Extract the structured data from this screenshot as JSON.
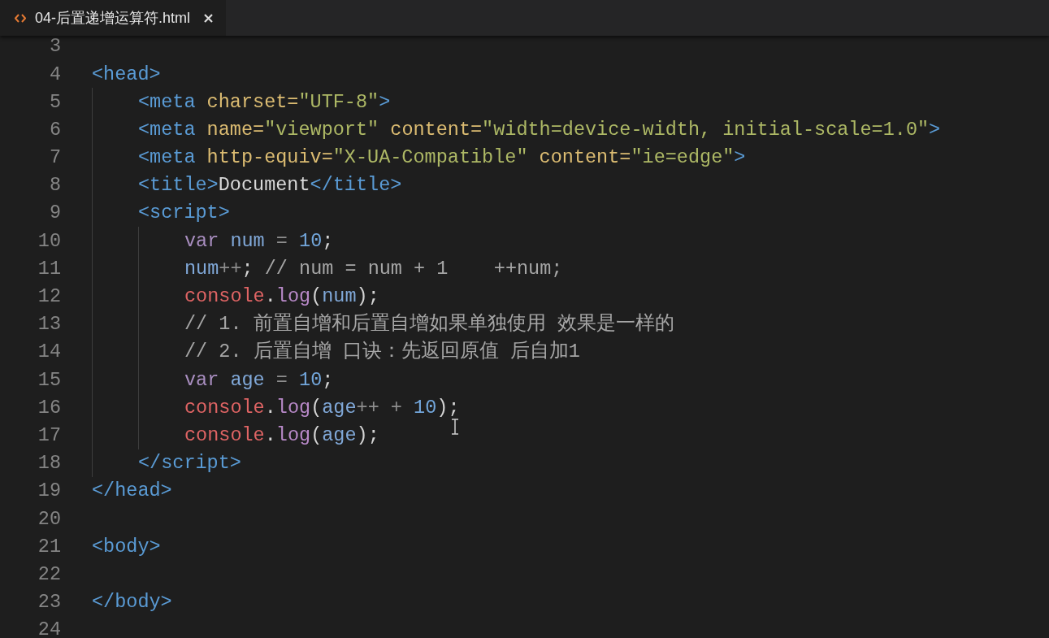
{
  "tabs": [
    {
      "title": "04-后置递增运算符.html",
      "selected": true
    }
  ],
  "lines": [
    {
      "number": "3"
    },
    {
      "number": "4",
      "tokens": [
        {
          "text": "<head>",
          "kind": "tag"
        }
      ],
      "children": [
        {
          "number": "5",
          "tokens": [
            {
              "text": "<meta",
              "kind": "tag"
            },
            {
              "text": " charset=",
              "kind": "attr"
            },
            {
              "text": "\"UTF-8\"",
              "kind": "string"
            },
            {
              "text": ">",
              "kind": "tag"
            }
          ]
        },
        {
          "number": "6",
          "tokens": [
            {
              "text": "<meta",
              "kind": "tag"
            },
            {
              "text": " name=",
              "kind": "attr"
            },
            {
              "text": "\"viewport\"",
              "kind": "string"
            },
            {
              "text": " content=",
              "kind": "attr"
            },
            {
              "text": "\"width=device-width, initial-scale=1.0\"",
              "kind": "string"
            },
            {
              "text": ">",
              "kind": "tag"
            }
          ]
        },
        {
          "number": "7",
          "tokens": [
            {
              "text": "<meta",
              "kind": "tag"
            },
            {
              "text": " http-equiv=",
              "kind": "attr"
            },
            {
              "text": "\"X-UA-Compatible\"",
              "kind": "string"
            },
            {
              "text": " content=",
              "kind": "attr"
            },
            {
              "text": "\"ie=edge\"",
              "kind": "string"
            },
            {
              "text": ">",
              "kind": "tag"
            }
          ]
        },
        {
          "number": "8",
          "tokens": [
            {
              "text": "<title>",
              "kind": "tag"
            },
            {
              "text": "Document",
              "kind": "text"
            },
            {
              "text": "</title>",
              "kind": "tag"
            }
          ]
        },
        {
          "number": "9",
          "tokens": [
            {
              "text": "<script>",
              "kind": "tag"
            }
          ],
          "children": [
            {
              "number": "10",
              "tokens": [
                {
                  "text": "var",
                  "kind": "keyword"
                },
                {
                  "text": " num",
                  "kind": "variable"
                },
                {
                  "text": " = ",
                  "kind": "operator"
                },
                {
                  "text": "10",
                  "kind": "number"
                },
                {
                  "text": ";",
                  "kind": "punct"
                }
              ]
            },
            {
              "number": "11",
              "tokens": [
                {
                  "text": "num",
                  "kind": "variable"
                },
                {
                  "text": "++",
                  "kind": "operator"
                },
                {
                  "text": ";",
                  "kind": "punct"
                },
                {
                  "text": " // num = num + 1    ++num;",
                  "kind": "comment"
                }
              ]
            },
            {
              "number": "12",
              "tokens": [
                {
                  "text": "console",
                  "kind": "object"
                },
                {
                  "text": ".",
                  "kind": "punct"
                },
                {
                  "text": "log",
                  "kind": "method"
                },
                {
                  "text": "(",
                  "kind": "punct"
                },
                {
                  "text": "num",
                  "kind": "variable"
                },
                {
                  "text": ");",
                  "kind": "punct"
                }
              ]
            },
            {
              "number": "13",
              "tokens": [
                {
                  "text": "// 1. 前置自增和后置自增如果单独使用 效果是一样的",
                  "kind": "comment"
                }
              ]
            },
            {
              "number": "14",
              "tokens": [
                {
                  "text": "// 2. 后置自增 口诀：先返回原值 后自加1",
                  "kind": "comment"
                }
              ]
            },
            {
              "number": "15",
              "tokens": [
                {
                  "text": "var",
                  "kind": "keyword"
                },
                {
                  "text": " age",
                  "kind": "variable"
                },
                {
                  "text": " = ",
                  "kind": "operator"
                },
                {
                  "text": "10",
                  "kind": "number"
                },
                {
                  "text": ";",
                  "kind": "punct"
                }
              ]
            },
            {
              "number": "16",
              "tokens": [
                {
                  "text": "console",
                  "kind": "object"
                },
                {
                  "text": ".",
                  "kind": "punct"
                },
                {
                  "text": "log",
                  "kind": "method"
                },
                {
                  "text": "(",
                  "kind": "punct"
                },
                {
                  "text": "age",
                  "kind": "variable"
                },
                {
                  "text": "++ + ",
                  "kind": "operator"
                },
                {
                  "text": "10",
                  "kind": "number"
                },
                {
                  "text": ");",
                  "kind": "punct"
                }
              ]
            },
            {
              "number": "17",
              "tokens": [
                {
                  "text": "console",
                  "kind": "object"
                },
                {
                  "text": ".",
                  "kind": "punct"
                },
                {
                  "text": "log",
                  "kind": "method"
                },
                {
                  "text": "(",
                  "kind": "punct"
                },
                {
                  "text": "age",
                  "kind": "variable"
                },
                {
                  "text": ");",
                  "kind": "punct"
                }
              ]
            }
          ]
        },
        {
          "number": "18",
          "tokens": [
            {
              "text": "</script>",
              "kind": "tag"
            }
          ]
        }
      ]
    },
    {
      "number": "19",
      "tokens": [
        {
          "text": "</head>",
          "kind": "tag"
        }
      ]
    },
    {
      "number": "20"
    },
    {
      "number": "21",
      "tokens": [
        {
          "text": "<body>",
          "kind": "tag"
        }
      ]
    },
    {
      "number": "22"
    },
    {
      "number": "23",
      "tokens": [
        {
          "text": "</body>",
          "kind": "tag"
        }
      ]
    },
    {
      "number": "24"
    }
  ]
}
